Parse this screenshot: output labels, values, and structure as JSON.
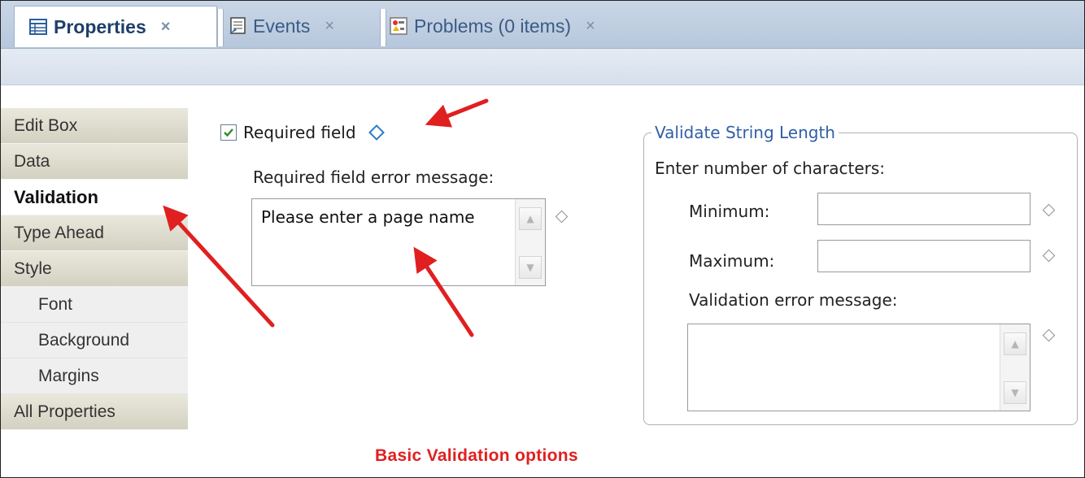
{
  "tabs": [
    {
      "label": "Properties",
      "icon": "properties-table-icon",
      "active": true
    },
    {
      "label": "Events",
      "icon": "events-icon",
      "active": false
    },
    {
      "label": "Problems (0 items)",
      "icon": "problems-icon",
      "active": false
    }
  ],
  "tab_close_glyph": "×",
  "categories": [
    {
      "label": "Edit Box"
    },
    {
      "label": "Data"
    },
    {
      "label": "Validation",
      "selected": true
    },
    {
      "label": "Type Ahead"
    },
    {
      "label": "Style"
    },
    {
      "label": "Font",
      "sub": true
    },
    {
      "label": "Background",
      "sub": true
    },
    {
      "label": "Margins",
      "sub": true
    },
    {
      "label": "All Properties"
    }
  ],
  "validation": {
    "required_label": "Required field",
    "required_checked": true,
    "error_msg_label": "Required field error message:",
    "error_msg_value": "Please enter a page name"
  },
  "string_length": {
    "legend": "Validate String Length",
    "instructions": "Enter number of characters:",
    "minimum_label": "Minimum:",
    "minimum_value": "",
    "maximum_label": "Maximum:",
    "maximum_value": "",
    "validation_msg_label": "Validation error message:",
    "validation_msg_value": ""
  },
  "caption": "Basic Validation options",
  "colors": {
    "accent_blue": "#2f5fa8",
    "annotation_red": "#e02020"
  }
}
